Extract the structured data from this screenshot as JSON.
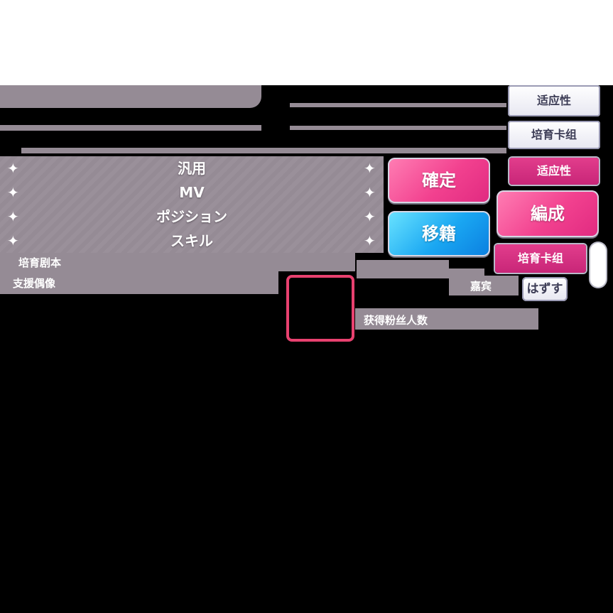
{
  "list": {
    "rows": [
      {
        "label": "汎用"
      },
      {
        "label": "MV"
      },
      {
        "label": "ポジション"
      },
      {
        "label": "スキル"
      }
    ],
    "sparkle_glyph": "✦"
  },
  "labels": {
    "training_script": "培育剧本",
    "support_idol": "支援偶像",
    "guest": "嘉宾",
    "fans_gained": "获得粉丝人数"
  },
  "buttons": {
    "confirm": "確定",
    "transfer": "移籍",
    "formation": "編成",
    "remove": "はずす"
  },
  "tabs": {
    "aptitude": "适应性",
    "deck": "培育卡组",
    "aptitude_active": "适应性",
    "deck_active": "培育卡组"
  },
  "colors": {
    "accent_pink": "#f2418f",
    "accent_blue": "#1aa7f2",
    "panel_gray": "#958b95",
    "frame_pink": "#e8416f"
  }
}
